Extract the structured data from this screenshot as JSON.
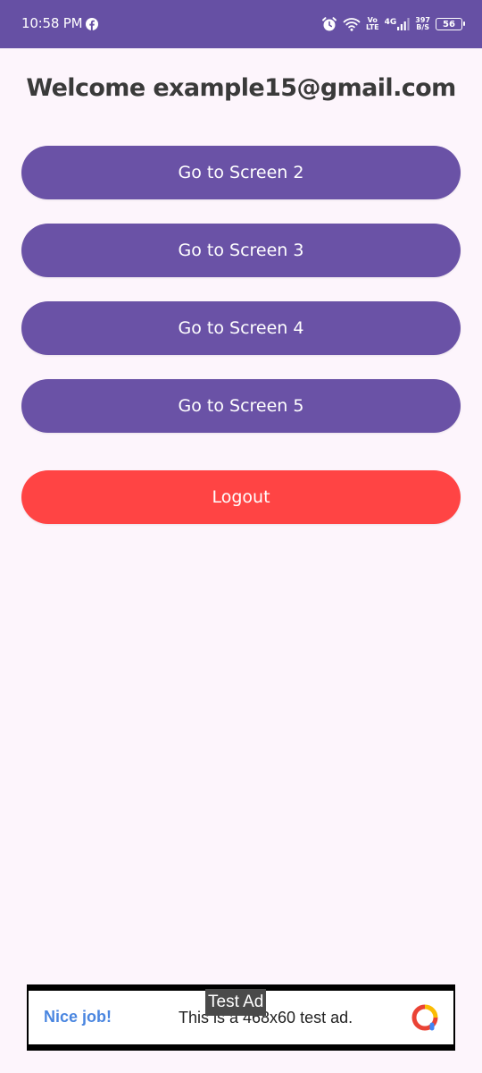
{
  "status_bar": {
    "time": "10:58 PM",
    "app_icon": "facebook-icon",
    "alarm_icon": "alarm-icon",
    "wifi_icon": "wifi-icon",
    "volte_top": "Vo",
    "volte_bottom": "LTE",
    "network": "4G",
    "signal_icon": "signal-bars-icon",
    "speed_value": "397",
    "speed_unit": "B/S",
    "battery_level": "56",
    "background_color": "#6650a4"
  },
  "welcome_text": "Welcome example15@gmail.com",
  "buttons": [
    {
      "label": "Go to Screen 2"
    },
    {
      "label": "Go to Screen 3"
    },
    {
      "label": "Go to Screen 4"
    },
    {
      "label": "Go to Screen 5"
    }
  ],
  "logout": {
    "label": "Logout",
    "color": "#ff4444"
  },
  "button_color": "#6a52a6",
  "ad": {
    "label": "Test Ad",
    "headline": "Nice job!",
    "body": "This is a 468x60 test ad.",
    "logo_icon": "admob-logo-icon"
  }
}
